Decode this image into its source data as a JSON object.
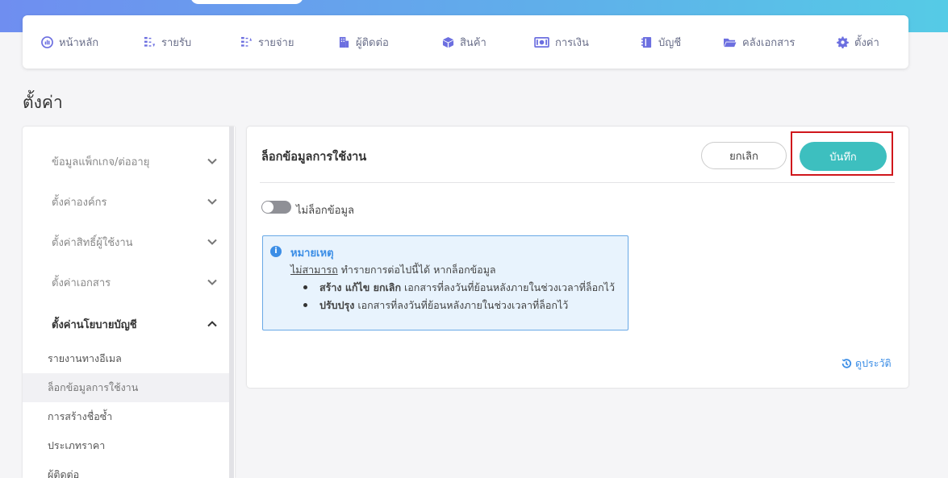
{
  "nav": {
    "items": [
      {
        "label": "หน้าหลัก",
        "icon": "dashboard-icon"
      },
      {
        "label": "รายรับ",
        "icon": "income-icon"
      },
      {
        "label": "รายจ่าย",
        "icon": "expense-icon"
      },
      {
        "label": "ผู้ติดต่อ",
        "icon": "contacts-icon"
      },
      {
        "label": "สินค้า",
        "icon": "box-icon"
      },
      {
        "label": "การเงิน",
        "icon": "money-icon"
      },
      {
        "label": "บัญชี",
        "icon": "book-icon"
      },
      {
        "label": "คลังเอกสาร",
        "icon": "folder-icon"
      },
      {
        "label": "ตั้งค่า",
        "icon": "gear-icon"
      }
    ]
  },
  "page": {
    "title": "ตั้งค่า"
  },
  "sidebar": {
    "sections": [
      {
        "label": "ข้อมูลแพ็กเกจ/ต่ออายุ",
        "expanded": false
      },
      {
        "label": "ตั้งค่าองค์กร",
        "expanded": false
      },
      {
        "label": "ตั้งค่าสิทธิ์ผู้ใช้งาน",
        "expanded": false
      },
      {
        "label": "ตั้งค่าเอกสาร",
        "expanded": false
      },
      {
        "label": "ตั้งค่านโยบายบัญชี",
        "expanded": true
      }
    ],
    "subitems": [
      {
        "label": "รายงานทางอีเมล",
        "active": false
      },
      {
        "label": "ล็อกข้อมูลการใช้งาน",
        "active": true
      },
      {
        "label": "การสร้างชื่อซ้ำ",
        "active": false
      },
      {
        "label": "ประเภทราคา",
        "active": false
      },
      {
        "label": "ผู้ติดต่อ",
        "active": false
      }
    ]
  },
  "main": {
    "title": "ล็อกข้อมูลการใช้งาน",
    "cancel_label": "ยกเลิก",
    "save_label": "บันทึก",
    "toggle": {
      "label": "ไม่ล็อกข้อมูล",
      "on": false
    },
    "note": {
      "icon_glyph": "i",
      "title": "หมายเหตุ",
      "underline": "ไม่สามารถ",
      "line1_rest": " ทำรายการต่อไปนี้ได้ หากล็อกข้อมูล",
      "bullet1_bold": "สร้าง แก้ไข ยกเลิก",
      "bullet1_rest": " เอกสารที่ลงวันที่ย้อนหลังภายในช่วงเวลาที่ล็อกไว้",
      "bullet2_bold": "ปรับปรุง",
      "bullet2_rest": " เอกสารที่ลงวันที่ย้อนหลังภายในช่วงเวลาที่ล็อกไว้"
    },
    "history_label": "ดูประวัติ"
  },
  "colors": {
    "accent": "#3dbfbf",
    "highlight": "#d0161c",
    "info": "#3c8ee6",
    "nav_icon": "#6c6fe0"
  }
}
